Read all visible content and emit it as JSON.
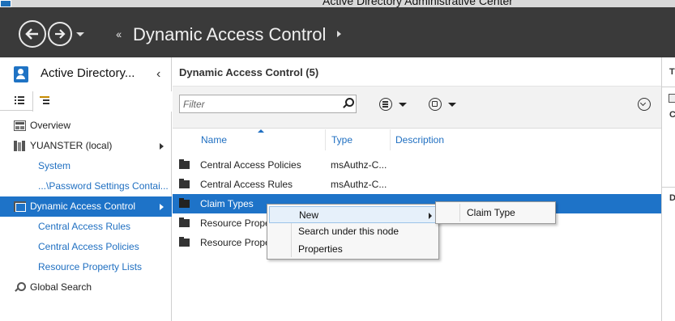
{
  "window": {
    "title": "Active Directory Administrative Center"
  },
  "header": {
    "back_icon": "back-arrow-icon",
    "forward_icon": "forward-arrow-icon",
    "breadcrumb_prefix": "‹‹",
    "breadcrumb_title": "Dynamic Access Control"
  },
  "sidebar": {
    "title": "Active Directory...",
    "items": [
      {
        "label": "Overview",
        "icon": "overview-icon"
      },
      {
        "label": "YUANSTER (local)",
        "icon": "domain-icon"
      },
      {
        "label": "System"
      },
      {
        "label": "...\\Password Settings Contai..."
      },
      {
        "label": "Dynamic Access Control",
        "icon": "dac-icon"
      },
      {
        "label": "Central Access Rules"
      },
      {
        "label": "Central Access Policies"
      },
      {
        "label": "Resource Property Lists"
      },
      {
        "label": "Global Search",
        "icon": "search-icon"
      }
    ]
  },
  "main": {
    "title": "Dynamic Access Control  (5)",
    "filter_placeholder": "Filter",
    "columns": [
      "Name",
      "Type",
      "Description"
    ],
    "rows": [
      {
        "name": "Central Access Policies",
        "type": "msAuthz-C..."
      },
      {
        "name": "Central Access Rules",
        "type": "msAuthz-C..."
      },
      {
        "name": "Claim Types",
        "type": ""
      },
      {
        "name": "Resource Prope",
        "type": ""
      },
      {
        "name": "Resource Prope",
        "type": ""
      }
    ]
  },
  "right_strip": {
    "t": "T",
    "c": "C",
    "d": "D"
  },
  "context_menu": {
    "items": [
      "New",
      "Search under this node",
      "Properties"
    ],
    "submenu": [
      "Claim Type"
    ]
  },
  "colors": {
    "accent": "#1e73c8",
    "header": "#3a3a3a",
    "link": "#1f6fc1"
  }
}
